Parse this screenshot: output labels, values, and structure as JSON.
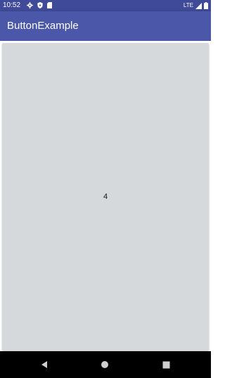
{
  "status_bar": {
    "time": "10:52",
    "network": "LTE",
    "left_icons": [
      "gear-icon",
      "shield-icon",
      "sd-card-icon"
    ],
    "right_icons": [
      "signal-icon",
      "battery-icon"
    ]
  },
  "app_bar": {
    "title": "ButtonExample"
  },
  "main": {
    "button_label": "4"
  },
  "nav_bar": {
    "buttons": [
      "back-icon",
      "home-icon",
      "recents-icon"
    ]
  },
  "colors": {
    "status_bar": "#3f4a98",
    "app_bar": "#4b57a8",
    "button_bg": "#d6d9db",
    "nav_bar": "#000000"
  }
}
